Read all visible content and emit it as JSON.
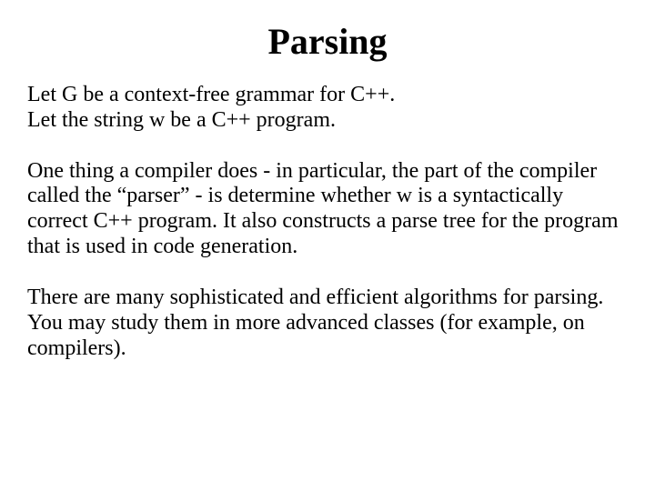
{
  "slide": {
    "title": "Parsing",
    "p1_line1": "Let G be a context-free grammar for C++.",
    "p1_line2": "Let the string w be a C++ program.",
    "p2": "One thing a compiler does - in particular, the part of the compiler called the “parser” - is determine whether w is a syntactically correct C++ program.  It also constructs a parse tree for the program that is used in code generation.",
    "p3": "There are many sophisticated and efficient algorithms for parsing. You may study them in more advanced classes (for example, on compilers)."
  }
}
